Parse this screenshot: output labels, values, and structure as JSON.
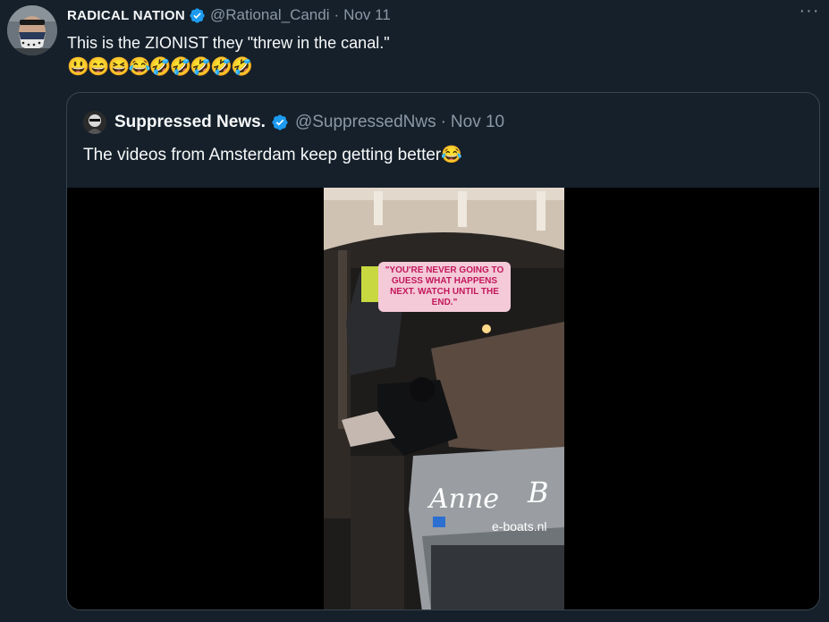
{
  "tweet": {
    "author_name": "RADICAL NATION",
    "handle": "@Rational_Candi",
    "separator": "·",
    "date": "Nov 11",
    "more_label": "···",
    "text": "This is the ZIONIST they \"threw in the canal.\"",
    "emojis": "😃😄😆😂🤣🤣🤣🤣🤣"
  },
  "quoted": {
    "author_name": "Suppressed News.",
    "handle": "@SuppressedNws",
    "separator": "·",
    "date": "Nov 10",
    "text": "The videos from Amsterdam keep getting better😂",
    "video": {
      "caption": "\"YOU'RE NEVER GOING TO GUESS WHAT HAPPENS NEXT. WATCH UNTIL THE END.\"",
      "boat_name": "Anne",
      "boat_name_2": "B",
      "boat_site": "e-boats.nl"
    }
  },
  "colors": {
    "background": "#15202b",
    "text": "#f7f9f9",
    "muted": "#8b98a5",
    "verified": "#1d9bf0",
    "border": "#38444d"
  }
}
